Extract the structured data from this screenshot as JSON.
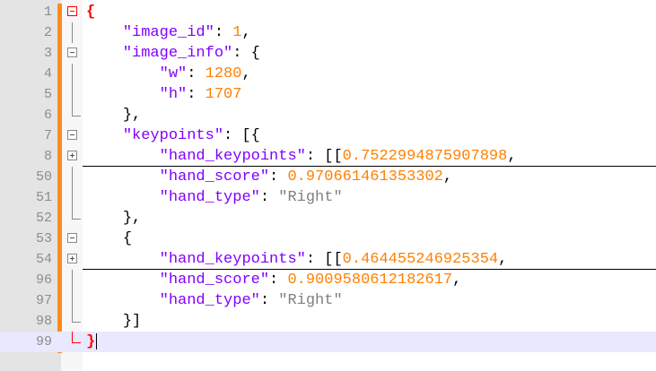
{
  "editor": {
    "lines": [
      {
        "num": "1",
        "indent": "",
        "tokens": [
          {
            "t": "{",
            "c": "rb"
          }
        ],
        "fold": "root-open"
      },
      {
        "num": "2",
        "indent": "    ",
        "tokens": [
          {
            "t": "\"image_id\"",
            "c": "k"
          },
          {
            "t": ": ",
            "c": "p"
          },
          {
            "t": "1",
            "c": "n"
          },
          {
            "t": ",",
            "c": "p"
          }
        ],
        "fold": "line"
      },
      {
        "num": "3",
        "indent": "    ",
        "tokens": [
          {
            "t": "\"image_info\"",
            "c": "k"
          },
          {
            "t": ": {",
            "c": "p"
          }
        ],
        "fold": "open"
      },
      {
        "num": "4",
        "indent": "        ",
        "tokens": [
          {
            "t": "\"w\"",
            "c": "k"
          },
          {
            "t": ": ",
            "c": "p"
          },
          {
            "t": "1280",
            "c": "n"
          },
          {
            "t": ",",
            "c": "p"
          }
        ],
        "fold": "line"
      },
      {
        "num": "5",
        "indent": "        ",
        "tokens": [
          {
            "t": "\"h\"",
            "c": "k"
          },
          {
            "t": ": ",
            "c": "p"
          },
          {
            "t": "1707",
            "c": "n"
          }
        ],
        "fold": "line"
      },
      {
        "num": "6",
        "indent": "    ",
        "tokens": [
          {
            "t": "},",
            "c": "p"
          }
        ],
        "fold": "end"
      },
      {
        "num": "7",
        "indent": "    ",
        "tokens": [
          {
            "t": "\"keypoints\"",
            "c": "k"
          },
          {
            "t": ": [{",
            "c": "p"
          }
        ],
        "fold": "open"
      },
      {
        "num": "8",
        "indent": "        ",
        "tokens": [
          {
            "t": "\"hand_keypoints\"",
            "c": "k"
          },
          {
            "t": ": [[",
            "c": "p"
          },
          {
            "t": "0.7522994875907898",
            "c": "n"
          },
          {
            "t": ",",
            "c": "p"
          }
        ],
        "fold": "plus",
        "folded": true
      },
      {
        "num": "50",
        "indent": "        ",
        "tokens": [
          {
            "t": "\"hand_score\"",
            "c": "k"
          },
          {
            "t": ": ",
            "c": "p"
          },
          {
            "t": "0.970661461353302",
            "c": "n"
          },
          {
            "t": ",",
            "c": "p"
          }
        ],
        "fold": "line"
      },
      {
        "num": "51",
        "indent": "        ",
        "tokens": [
          {
            "t": "\"hand_type\"",
            "c": "k"
          },
          {
            "t": ": ",
            "c": "p"
          },
          {
            "t": "\"Right\"",
            "c": "s"
          }
        ],
        "fold": "line"
      },
      {
        "num": "52",
        "indent": "    ",
        "tokens": [
          {
            "t": "},",
            "c": "p"
          }
        ],
        "fold": "end"
      },
      {
        "num": "53",
        "indent": "    ",
        "tokens": [
          {
            "t": "{",
            "c": "p"
          }
        ],
        "fold": "open"
      },
      {
        "num": "54",
        "indent": "        ",
        "tokens": [
          {
            "t": "\"hand_keypoints\"",
            "c": "k"
          },
          {
            "t": ": [[",
            "c": "p"
          },
          {
            "t": "0.464455246925354",
            "c": "n"
          },
          {
            "t": ",",
            "c": "p"
          }
        ],
        "fold": "plus",
        "folded": true
      },
      {
        "num": "96",
        "indent": "        ",
        "tokens": [
          {
            "t": "\"hand_score\"",
            "c": "k"
          },
          {
            "t": ": ",
            "c": "p"
          },
          {
            "t": "0.9009580612182617",
            "c": "n"
          },
          {
            "t": ",",
            "c": "p"
          }
        ],
        "fold": "line"
      },
      {
        "num": "97",
        "indent": "        ",
        "tokens": [
          {
            "t": "\"hand_type\"",
            "c": "k"
          },
          {
            "t": ": ",
            "c": "p"
          },
          {
            "t": "\"Right\"",
            "c": "s"
          }
        ],
        "fold": "line"
      },
      {
        "num": "98",
        "indent": "    ",
        "tokens": [
          {
            "t": "}]",
            "c": "p"
          }
        ],
        "fold": "end"
      },
      {
        "num": "99",
        "indent": "",
        "tokens": [
          {
            "t": "}",
            "c": "rb"
          }
        ],
        "fold": "root-end",
        "current": true
      }
    ],
    "colors": {
      "key": "#8000ff",
      "number": "#ff8000",
      "string": "#808080",
      "brace_root": "#ff0000",
      "change_bar": "#ff8a1c",
      "current_line": "#e8e8ff",
      "gutter": "#e4e4e4"
    }
  }
}
